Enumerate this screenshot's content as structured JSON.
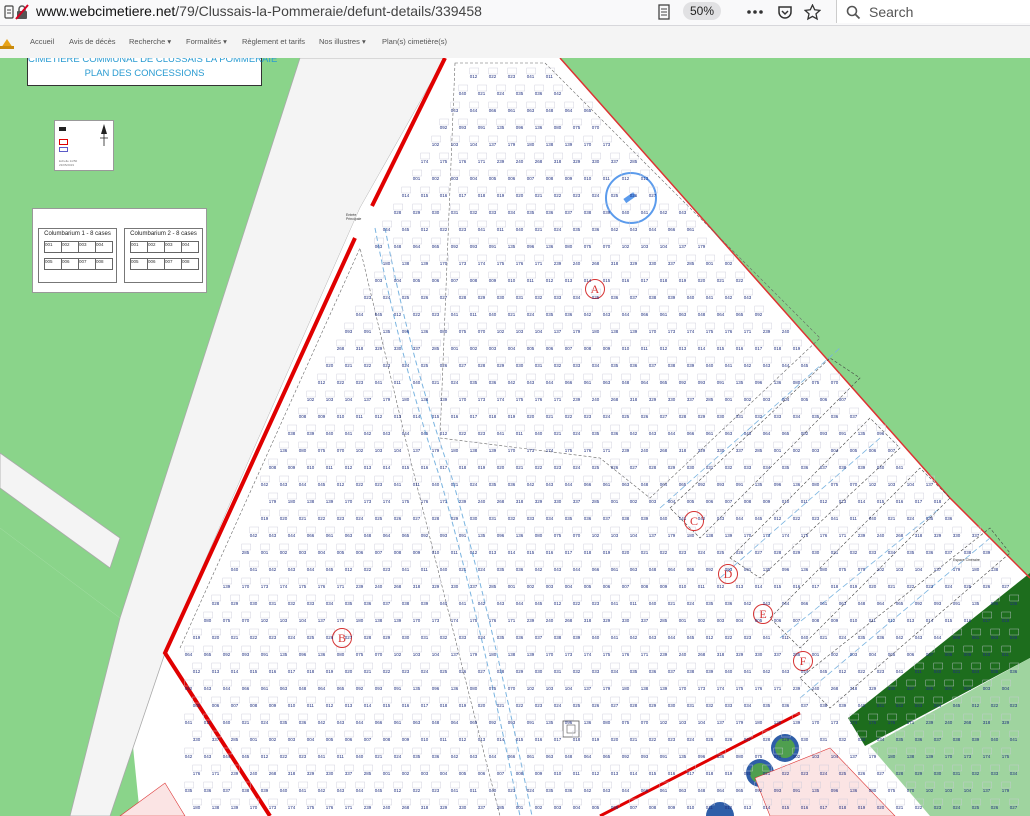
{
  "browser": {
    "url_host": "www.webcimetiere.net",
    "url_path": "/79/Clussais-la-Pommeraie/defunt-details/339458",
    "zoom": "50%",
    "search_placeholder": "Search",
    "icons": [
      "page-info-icon",
      "connection-warning-icon",
      "reader-view-icon",
      "more-actions-icon",
      "pocket-icon",
      "bookmark-star-icon",
      "search-icon"
    ]
  },
  "site_nav": {
    "items": [
      "Accueil",
      "Avis de décès",
      "Recherche",
      "Formalités",
      "Règlement et tarifs",
      "Nos illustres",
      "Plan(s) cimetière(s)"
    ],
    "dropdown_marker": "▾"
  },
  "map": {
    "title_line1": "CIMETIERE COMMUNAL DE CLUSSAIS LA POMMERAIE",
    "title_line2": "PLAN DES CONCESSIONS",
    "legend": {
      "scale": "Echelle 1/250",
      "date": "23/05/2019"
    },
    "columbarium": [
      {
        "title": "Columbarium 1 - 8 cases",
        "cases": [
          "001",
          "002",
          "003",
          "004",
          "005",
          "006",
          "007",
          "008"
        ]
      },
      {
        "title": "Columbarium 2 - 8 cases",
        "cases": [
          "001",
          "002",
          "003",
          "004",
          "005",
          "006",
          "007",
          "008"
        ]
      }
    ],
    "zones": [
      "A",
      "B",
      "C",
      "D",
      "E",
      "F"
    ],
    "entry_label": "Entrée Principale",
    "parking_label": "Espace Cinéraire",
    "colors": {
      "wall": "#e00000",
      "grass": "#8ad48a",
      "dark_grass": "#1d6d1d",
      "path_blue": "#7ab4e0",
      "grave_numbers": "#203080",
      "zone_labels": "#d63333",
      "highlight_circle": "#5b9bec"
    },
    "grave_numbers_sample": [
      "012",
      "022",
      "023",
      "041",
      "011",
      "040",
      "021",
      "024",
      "035",
      "036",
      "042",
      "043",
      "044",
      "066",
      "061",
      "063",
      "048",
      "064",
      "065",
      "092",
      "093",
      "091",
      "135",
      "096",
      "136",
      "080",
      "075",
      "070",
      "102",
      "103",
      "104",
      "137",
      "179",
      "180",
      "138",
      "139",
      "170",
      "173",
      "174",
      "175",
      "176",
      "171",
      "239",
      "240",
      "268",
      "318",
      "329",
      "330",
      "337",
      "285",
      "001",
      "002",
      "003",
      "004",
      "005",
      "006",
      "007",
      "008",
      "009",
      "010",
      "011",
      "012",
      "013",
      "014",
      "015",
      "016",
      "017",
      "018",
      "019",
      "020",
      "021",
      "022",
      "023",
      "024",
      "025",
      "026",
      "027",
      "028",
      "029",
      "030",
      "031",
      "032",
      "033",
      "034",
      "035",
      "036",
      "037",
      "038",
      "039",
      "040",
      "041",
      "042",
      "043",
      "044",
      "045"
    ]
  }
}
